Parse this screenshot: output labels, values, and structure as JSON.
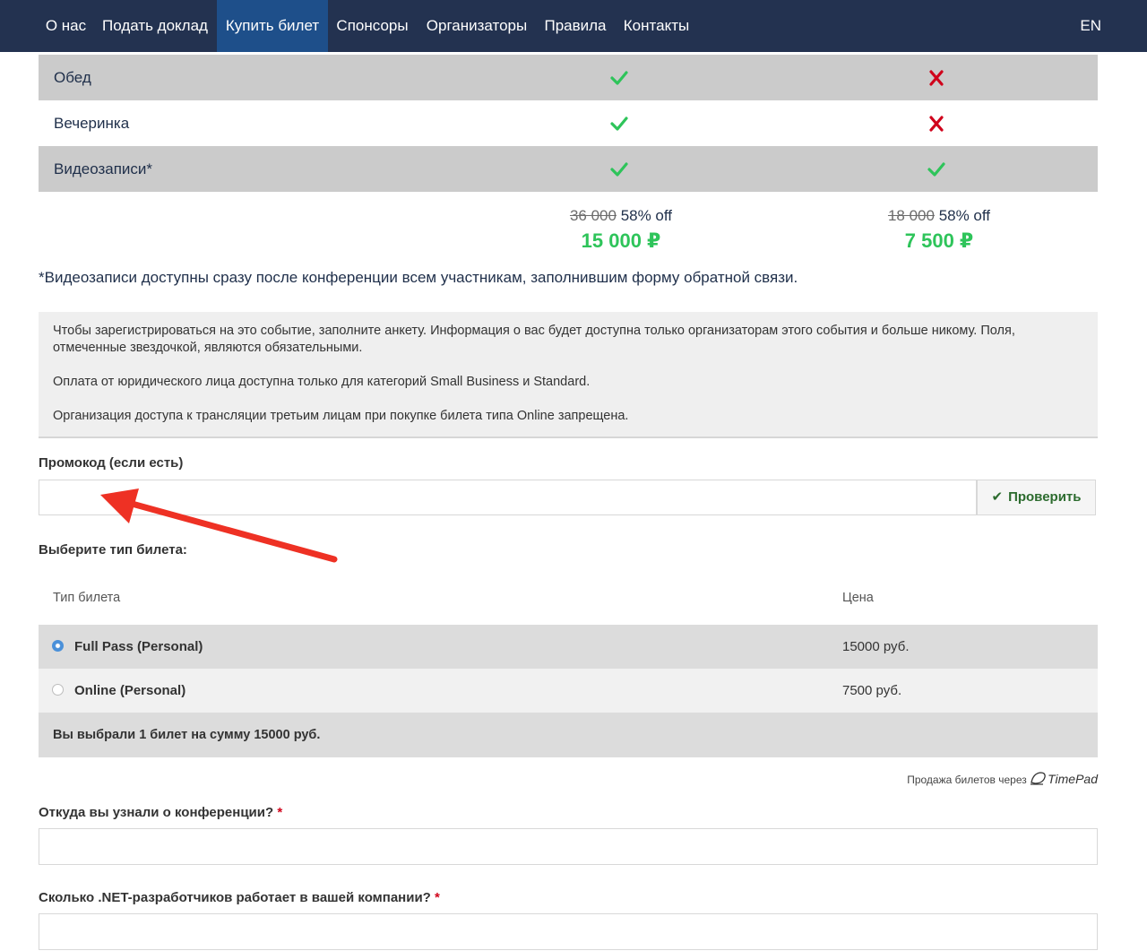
{
  "nav": {
    "items": [
      "О нас",
      "Подать доклад",
      "Купить билет",
      "Спонсоры",
      "Организаторы",
      "Правила",
      "Контакты"
    ],
    "active_index": 2,
    "lang": "EN"
  },
  "features": [
    {
      "label": "Обед",
      "col1": "check",
      "col2": "cross"
    },
    {
      "label": "Вечеринка",
      "col1": "check",
      "col2": "cross"
    },
    {
      "label": "Видеозаписи*",
      "col1": "check",
      "col2": "check"
    }
  ],
  "prices": [
    {
      "old": "36 000",
      "discount": "58% off",
      "new": "15 000 ₽"
    },
    {
      "old": "18 000",
      "discount": "58% off",
      "new": "7 500 ₽"
    }
  ],
  "footnote": "*Видеозаписи доступны сразу после конференции всем участникам, заполнившим форму обратной связи.",
  "info": {
    "p1": "Чтобы зарегистрироваться на это событие, заполните анкету. Информация о вас будет доступна только организаторам этого события и больше никому. Поля, отмеченные звездочкой, являются обязательными.",
    "p2": "Оплата от юридического лица доступна только для категорий Small Business и Standard.",
    "p3": "Организация доступа к трансляции третьим лицам при покупке билета типа Online запрещена."
  },
  "promo": {
    "label": "Промокод (если есть)",
    "value": "",
    "button": "Проверить"
  },
  "tickets": {
    "title": "Выберите тип билета:",
    "col_type": "Тип билета",
    "col_price": "Цена",
    "rows": [
      {
        "name": "Full Pass (Personal)",
        "price": "15000 руб.",
        "selected": true
      },
      {
        "name": "Online (Personal)",
        "price": "7500 руб.",
        "selected": false
      }
    ],
    "summary": "Вы выбрали 1 билет на сумму 15000 руб."
  },
  "timepad": {
    "text": "Продажа билетов через",
    "brand": "TimePad"
  },
  "questions": [
    {
      "label": "Откуда вы узнали о конференции?",
      "required": "*",
      "value": ""
    },
    {
      "label": "Сколько .NET-разработчиков работает в вашей компании?",
      "required": "*",
      "value": ""
    }
  ],
  "colors": {
    "nav_bg": "#233250",
    "nav_active": "#1e4f8a",
    "check": "#2ec45a",
    "cross": "#d0021b",
    "price_green": "#2ec45a",
    "arrow": "#ee3124"
  },
  "icons": {
    "check": "check-icon",
    "cross": "cross-icon",
    "button_tick": "check-icon",
    "timepad_logo": "timepad-logo-icon"
  }
}
